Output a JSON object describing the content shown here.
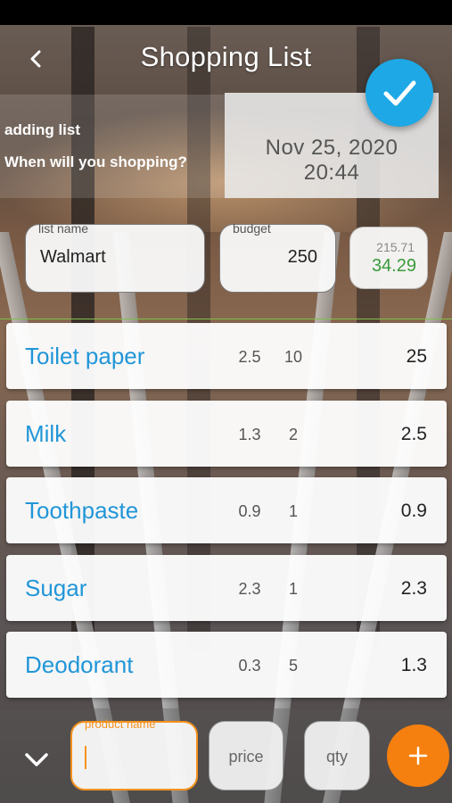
{
  "header": {
    "title": "Shopping List"
  },
  "info": {
    "adding_label": "adding list",
    "when_label": "When will you shopping?",
    "date": "Nov 25, 2020",
    "time": "20:44"
  },
  "fields": {
    "list_name_label": "list name",
    "list_name_value": "Walmart",
    "budget_label": "budget",
    "budget_value": "250",
    "spent": "215.71",
    "remaining": "34.29"
  },
  "items": [
    {
      "name": "Toilet paper",
      "price": "2.5",
      "qty": "10",
      "total": "25"
    },
    {
      "name": "Milk",
      "price": "1.3",
      "qty": "2",
      "total": "2.5"
    },
    {
      "name": "Toothpaste",
      "price": "0.9",
      "qty": "1",
      "total": "0.9"
    },
    {
      "name": "Sugar",
      "price": "2.3",
      "qty": "1",
      "total": "2.3"
    },
    {
      "name": "Deodorant",
      "price": "0.3",
      "qty": "5",
      "total": "1.3"
    }
  ],
  "entry": {
    "product_name_placeholder": "product name",
    "price_placeholder": "price",
    "qty_placeholder": "qty"
  },
  "colors": {
    "accent_blue": "#1ea8e6",
    "item_name_blue": "#2196d8",
    "accent_orange": "#f57f0f",
    "remaining_green": "#3a9a3a"
  },
  "icons": {
    "back": "chevron-left-icon",
    "confirm": "check-icon",
    "collapse": "chevron-down-icon",
    "add": "plus-icon"
  }
}
